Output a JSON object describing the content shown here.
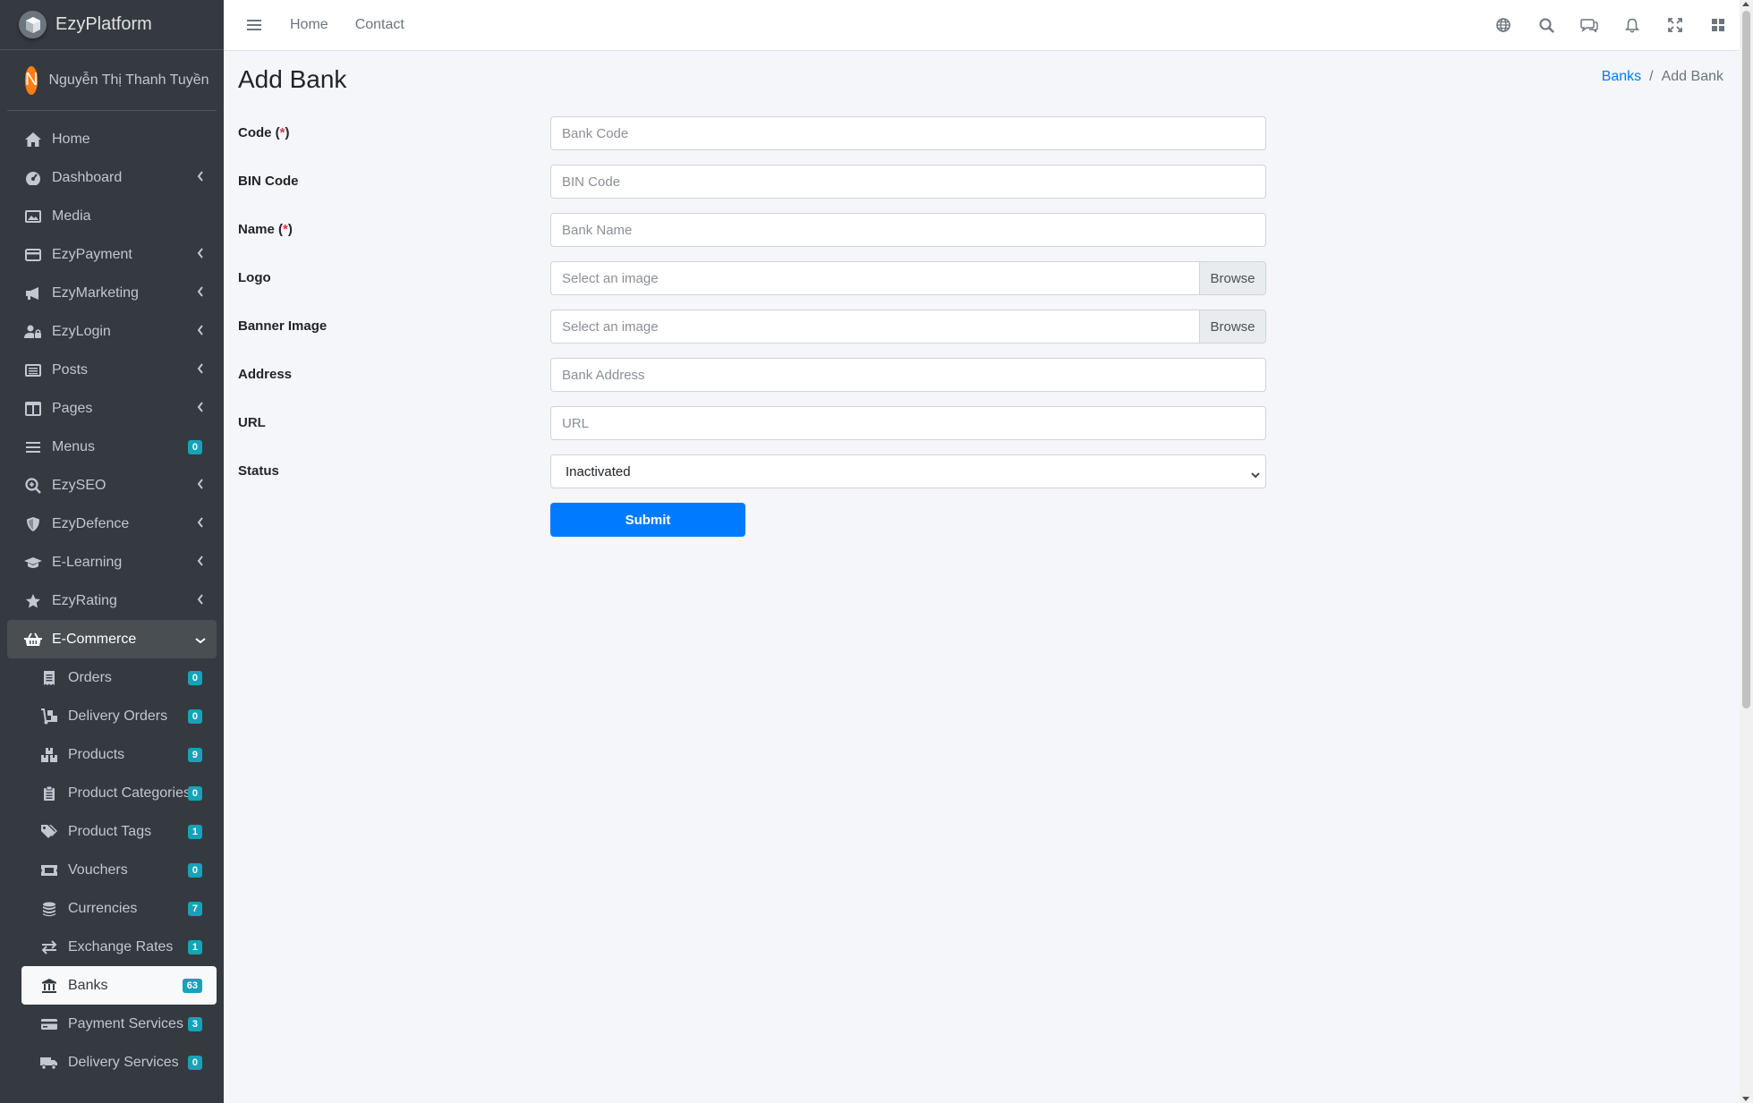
{
  "brand": {
    "name": "EzyPlatform",
    "icon": "platform-logo-icon"
  },
  "user": {
    "initial": "N",
    "name": "Nguyễn Thị Thanh Tuyền",
    "avatar_color": "#fd7e14"
  },
  "sidebar": {
    "items": [
      {
        "label": "Home",
        "icon": "home-icon",
        "arrow": false,
        "badge": ""
      },
      {
        "label": "Dashboard",
        "icon": "dashboard-icon",
        "arrow": true,
        "badge": ""
      },
      {
        "label": "Media",
        "icon": "image-icon",
        "arrow": false,
        "badge": ""
      },
      {
        "label": "EzyPayment",
        "icon": "credit-card-icon",
        "arrow": true,
        "badge": ""
      },
      {
        "label": "EzyMarketing",
        "icon": "megaphone-icon",
        "arrow": true,
        "badge": ""
      },
      {
        "label": "EzyLogin",
        "icon": "user-lock-icon",
        "arrow": true,
        "badge": ""
      },
      {
        "label": "Posts",
        "icon": "list-icon",
        "arrow": true,
        "badge": ""
      },
      {
        "label": "Pages",
        "icon": "columns-icon",
        "arrow": true,
        "badge": ""
      },
      {
        "label": "Menus",
        "icon": "bars-icon",
        "arrow": false,
        "badge": "0"
      },
      {
        "label": "EzySEO",
        "icon": "search-plus-icon",
        "arrow": true,
        "badge": ""
      },
      {
        "label": "EzyDefence",
        "icon": "shield-icon",
        "arrow": true,
        "badge": ""
      },
      {
        "label": "E-Learning",
        "icon": "graduation-cap-icon",
        "arrow": true,
        "badge": ""
      },
      {
        "label": "EzyRating",
        "icon": "star-icon",
        "arrow": true,
        "badge": ""
      },
      {
        "label": "E-Commerce",
        "icon": "basket-icon",
        "arrow": true,
        "badge": ""
      }
    ],
    "sub_items": [
      {
        "label": "Orders",
        "icon": "receipt-icon",
        "badge": "0"
      },
      {
        "label": "Delivery Orders",
        "icon": "dolly-icon",
        "badge": "0"
      },
      {
        "label": "Products",
        "icon": "boxes-icon",
        "badge": "9"
      },
      {
        "label": "Product Categories",
        "icon": "clipboard-list-icon",
        "badge": "0"
      },
      {
        "label": "Product Tags",
        "icon": "tags-icon",
        "badge": "1"
      },
      {
        "label": "Vouchers",
        "icon": "ticket-icon",
        "badge": "0"
      },
      {
        "label": "Currencies",
        "icon": "coins-icon",
        "badge": "7"
      },
      {
        "label": "Exchange Rates",
        "icon": "exchange-icon",
        "badge": "1"
      },
      {
        "label": "Banks",
        "icon": "bank-icon",
        "badge": "63"
      },
      {
        "label": "Payment Services",
        "icon": "credit-card-icon",
        "badge": "3"
      },
      {
        "label": "Delivery Services",
        "icon": "truck-icon",
        "badge": "0"
      }
    ]
  },
  "header": {
    "links": [
      "Home",
      "Contact"
    ],
    "icons": [
      "globe-icon",
      "search-icon",
      "comments-icon",
      "bell-icon",
      "expand-icon",
      "grid-icon"
    ]
  },
  "page": {
    "title": "Add Bank",
    "breadcrumb": {
      "parent": "Banks",
      "current": "Add Bank"
    }
  },
  "form": {
    "code": {
      "label": "Code",
      "required": "(*)",
      "placeholder": "Bank Code"
    },
    "bin": {
      "label": "BIN Code",
      "placeholder": "BIN Code"
    },
    "name": {
      "label": "Name",
      "required": "(*)",
      "placeholder": "Bank Name"
    },
    "logo": {
      "label": "Logo",
      "placeholder": "Select an image",
      "button": "Browse"
    },
    "banner": {
      "label": "Banner Image",
      "placeholder": "Select an image",
      "button": "Browse"
    },
    "address": {
      "label": "Address",
      "placeholder": "Bank Address"
    },
    "url": {
      "label": "URL",
      "placeholder": "URL"
    },
    "status": {
      "label": "Status",
      "value": "Inactivated"
    },
    "submit": "Submit"
  },
  "colors": {
    "primary": "#007bff",
    "sidebar_bg": "#343a40",
    "badge": "#17a2b8",
    "required": "#dc3545"
  }
}
